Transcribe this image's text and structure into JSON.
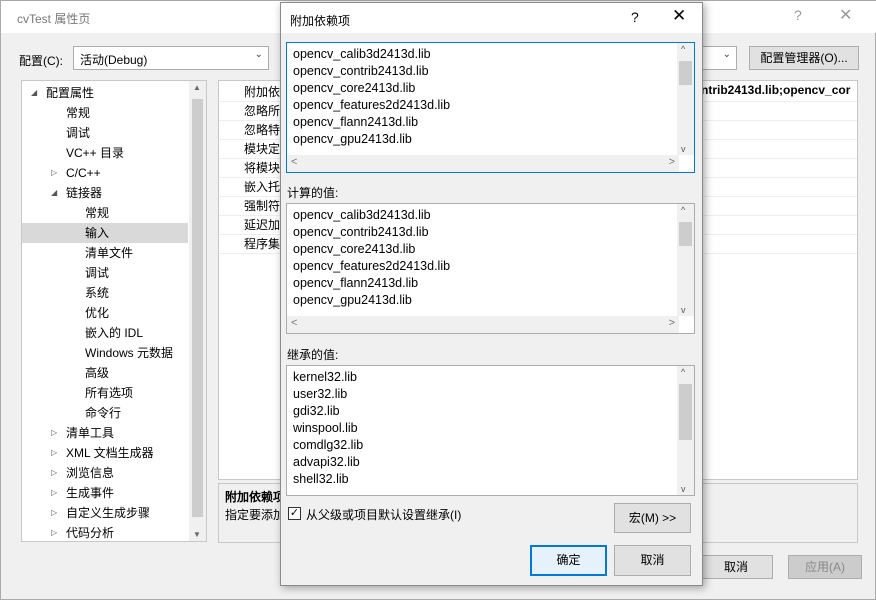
{
  "background_window": {
    "title": "cvTest 属性页",
    "help_glyph": "?",
    "close_glyph": "✕",
    "config_label": "配置(C):",
    "config_value": "活动(Debug)",
    "config_manager_label": "配置管理器(O)...",
    "tree": [
      {
        "label": "配置属性",
        "expander": "◢",
        "level": 0
      },
      {
        "label": "常规",
        "level": 1
      },
      {
        "label": "调试",
        "level": 1
      },
      {
        "label": "VC++ 目录",
        "level": 1
      },
      {
        "label": "C/C++",
        "expander": "▷",
        "level": 1
      },
      {
        "label": "链接器",
        "expander": "◢",
        "level": 1
      },
      {
        "label": "常规",
        "level": 2
      },
      {
        "label": "输入",
        "level": 2,
        "selected": true
      },
      {
        "label": "清单文件",
        "level": 2
      },
      {
        "label": "调试",
        "level": 2
      },
      {
        "label": "系统",
        "level": 2
      },
      {
        "label": "优化",
        "level": 2
      },
      {
        "label": "嵌入的 IDL",
        "level": 2
      },
      {
        "label": "Windows 元数据",
        "level": 2
      },
      {
        "label": "高级",
        "level": 2
      },
      {
        "label": "所有选项",
        "level": 2
      },
      {
        "label": "命令行",
        "level": 2
      },
      {
        "label": "清单工具",
        "expander": "▷",
        "level": 1
      },
      {
        "label": "XML 文档生成器",
        "expander": "▷",
        "level": 1
      },
      {
        "label": "浏览信息",
        "expander": "▷",
        "level": 1
      },
      {
        "label": "生成事件",
        "expander": "▷",
        "level": 1
      },
      {
        "label": "自定义生成步骤",
        "expander": "▷",
        "level": 1
      },
      {
        "label": "代码分析",
        "expander": "▷",
        "level": 1
      }
    ],
    "grid_rows": [
      "附加依",
      "忽略所",
      "忽略特",
      "模块定",
      "将模块",
      "嵌入托",
      "强制符",
      "延迟加",
      "程序集"
    ],
    "grid_first_value": "ntrib2413d.lib;opencv_cor",
    "desc_title": "附加依赖项",
    "desc_text": "指定要添加",
    "cancel_label": "取消",
    "apply_label": "应用(A)"
  },
  "dialog": {
    "title": "附加依赖项",
    "help_glyph": "?",
    "close_glyph": "✕",
    "edit_lines": [
      "opencv_calib3d2413d.lib",
      "opencv_contrib2413d.lib",
      "opencv_core2413d.lib",
      "opencv_features2d2413d.lib",
      "opencv_flann2413d.lib",
      "opencv_gpu2413d.lib"
    ],
    "calculated_label": "计算的值:",
    "calculated_lines": [
      "opencv_calib3d2413d.lib",
      "opencv_contrib2413d.lib",
      "opencv_core2413d.lib",
      "opencv_features2d2413d.lib",
      "opencv_flann2413d.lib",
      "opencv_gpu2413d.lib"
    ],
    "inherited_label": "继承的值:",
    "inherited_lines": [
      "kernel32.lib",
      "user32.lib",
      "gdi32.lib",
      "winspool.lib",
      "comdlg32.lib",
      "advapi32.lib",
      "shell32.lib"
    ],
    "inherit_checkbox_label": "从父级或项目默认设置继承(I)",
    "inherit_checked": true,
    "macro_button_label": "宏(M) >>",
    "ok_label": "确定",
    "cancel_label": "取消"
  }
}
